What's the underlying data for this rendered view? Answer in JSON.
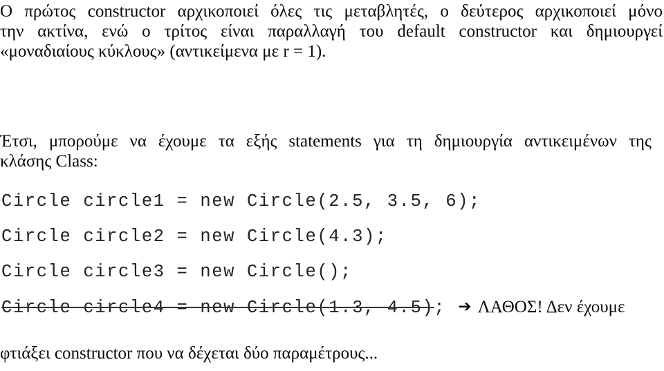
{
  "document": {
    "background_color": "#ffffff",
    "text_color": "#0a0a0a",
    "language": "Greek"
  },
  "paragraph_intro": {
    "name": "constructor-explanation",
    "line_1": "Ο πρώτος constructor αρχικοποιεί όλες τις μεταβλητές, ο δεύτερος αρχικοποιεί μόνο",
    "line_2": "την ακτίνα, ενώ ο τρίτος είναι παραλλαγή του default constructor και δημιουργεί",
    "line_3": "«μοναδιαίους κύκλους» (αντικείμενα με r = 1)."
  },
  "paragraph_statements": {
    "name": "statements-intro",
    "line_1": "Έτσι, μπορούμε να έχουμε τα εξής statements για τη δημιουργία αντικειμένων της",
    "line_2": "κλάσης Class:"
  },
  "code_block": {
    "lines": [
      {
        "id": "code-line-1",
        "text": "Circle circle1 = new Circle(2.5, 3.5, 6);",
        "struck": false,
        "tail": "",
        "annotation": ""
      },
      {
        "id": "code-line-2",
        "text": "Circle circle2 = new Circle(4.3);",
        "struck": false,
        "tail": "",
        "annotation": ""
      },
      {
        "id": "code-line-3",
        "text": "Circle circle3 = new Circle();",
        "struck": false,
        "tail": "",
        "annotation": ""
      },
      {
        "id": "code-line-4",
        "text": "Circle circle4 = new Circle(1.3, 4.5)",
        "struck": true,
        "tail": ";",
        "annotation": "ΛΑΘΟΣ! Δεν έχουμε",
        "arrow_glyph": "➔"
      }
    ]
  },
  "paragraph_closing": {
    "name": "error-explanation",
    "line_1": "φτιάξει constructor που να δέχεται δύο παραμέτρους..."
  }
}
